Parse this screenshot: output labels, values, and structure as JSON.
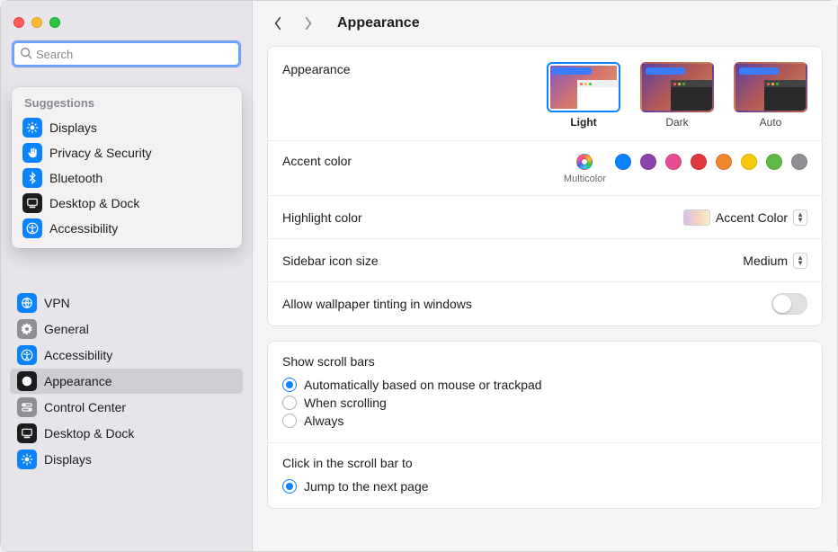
{
  "title": "Appearance",
  "search": {
    "placeholder": "Search"
  },
  "suggestions_header": "Suggestions",
  "suggestions": [
    {
      "label": "Displays",
      "icon": "sun-icon",
      "color": "blue"
    },
    {
      "label": "Privacy & Security",
      "icon": "hand-icon",
      "color": "blue"
    },
    {
      "label": "Bluetooth",
      "icon": "bluetooth-icon",
      "color": "blue"
    },
    {
      "label": "Desktop & Dock",
      "icon": "dock-icon",
      "color": "black"
    },
    {
      "label": "Accessibility",
      "icon": "accessibility-icon",
      "color": "blue"
    }
  ],
  "sidebar": [
    {
      "label": "VPN",
      "icon": "globe-icon",
      "color": "blue",
      "selected": false
    },
    {
      "label": "General",
      "icon": "gear-icon",
      "color": "gray",
      "selected": false
    },
    {
      "label": "Accessibility",
      "icon": "accessibility-icon",
      "color": "blue",
      "selected": false
    },
    {
      "label": "Appearance",
      "icon": "appearance-icon",
      "color": "black",
      "selected": true
    },
    {
      "label": "Control Center",
      "icon": "switches-icon",
      "color": "gray",
      "selected": false
    },
    {
      "label": "Desktop & Dock",
      "icon": "dock-icon",
      "color": "black",
      "selected": false
    },
    {
      "label": "Displays",
      "icon": "sun-icon",
      "color": "blue",
      "selected": false
    }
  ],
  "appearance_section": {
    "label": "Appearance",
    "options": [
      {
        "label": "Light",
        "selected": true,
        "dark": false
      },
      {
        "label": "Dark",
        "selected": false,
        "dark": true
      },
      {
        "label": "Auto",
        "selected": false,
        "dark": true
      }
    ]
  },
  "accent": {
    "label": "Accent color",
    "selected_label": "Multicolor",
    "colors": [
      {
        "name": "Multicolor",
        "css": "multicolor",
        "selected": true
      },
      {
        "name": "Blue",
        "css": "#0b83ff"
      },
      {
        "name": "Purple",
        "css": "#8c45ab"
      },
      {
        "name": "Pink",
        "css": "#e64d93"
      },
      {
        "name": "Red",
        "css": "#e0383e"
      },
      {
        "name": "Orange",
        "css": "#f0872d"
      },
      {
        "name": "Yellow",
        "css": "#f7c70a"
      },
      {
        "name": "Green",
        "css": "#62ba46"
      },
      {
        "name": "Graphite",
        "css": "#8e8e93"
      }
    ]
  },
  "highlight": {
    "label": "Highlight color",
    "value": "Accent Color"
  },
  "sidebar_icon": {
    "label": "Sidebar icon size",
    "value": "Medium"
  },
  "wallpaper_tint": {
    "label": "Allow wallpaper tinting in windows",
    "on": false
  },
  "scrollbars": {
    "label": "Show scroll bars",
    "options": [
      {
        "label": "Automatically based on mouse or trackpad",
        "checked": true
      },
      {
        "label": "When scrolling",
        "checked": false
      },
      {
        "label": "Always",
        "checked": false
      }
    ]
  },
  "click_scrollbar": {
    "label": "Click in the scroll bar to",
    "options": [
      {
        "label": "Jump to the next page",
        "checked": true
      }
    ]
  }
}
